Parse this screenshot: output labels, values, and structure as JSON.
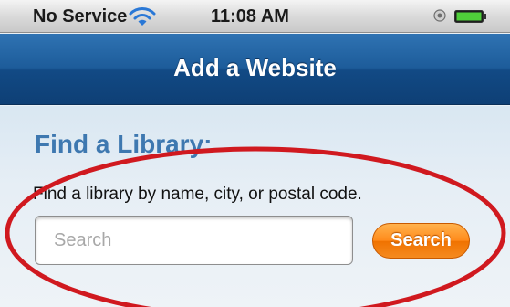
{
  "status_bar": {
    "carrier": "No Service",
    "time": "11:08 AM"
  },
  "nav": {
    "title": "Add a Website"
  },
  "content": {
    "heading": "Find a Library:",
    "helper_text": "Find a library by name, city, or postal code.",
    "search_placeholder": "Search",
    "search_button_label": "Search"
  },
  "icons": {
    "wifi": "wifi-icon",
    "lock": "lock-icon",
    "battery": "battery-icon"
  },
  "colors": {
    "nav_bar": "#1d5c9a",
    "heading": "#3e78b0",
    "search_button": "#ff8a1a",
    "annotation": "#d0191f"
  }
}
